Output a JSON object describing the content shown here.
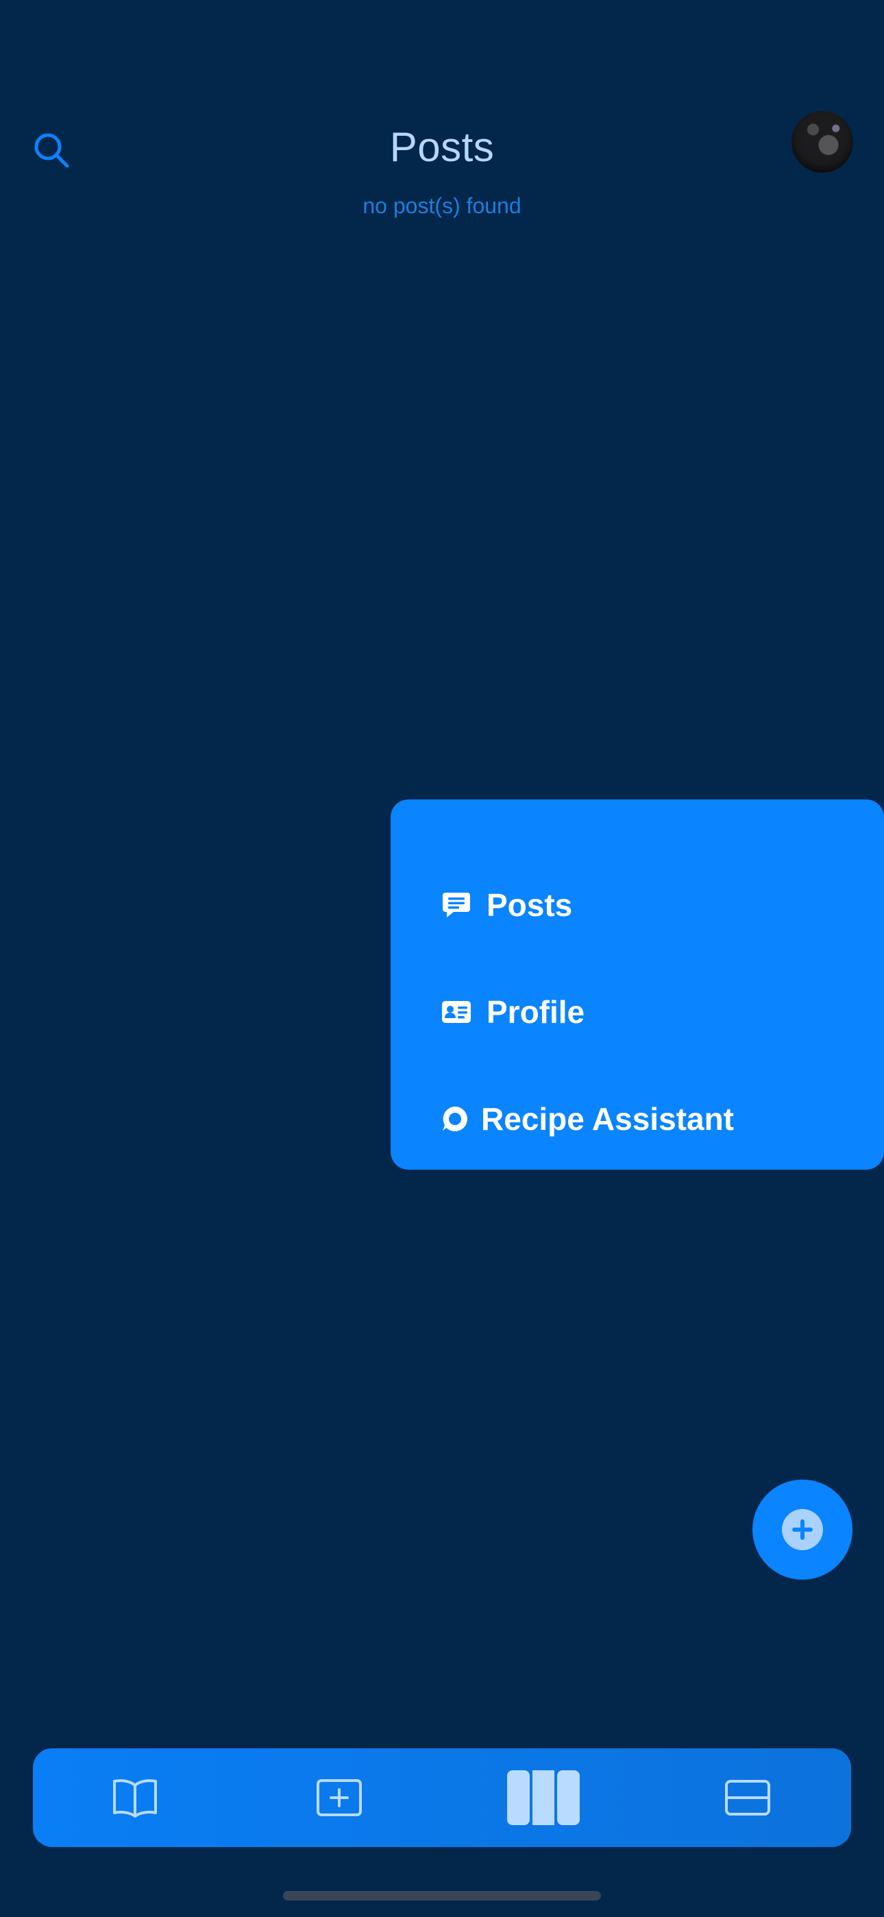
{
  "header": {
    "title": "Posts",
    "subtitle": "no post(s) found"
  },
  "menu": {
    "items": [
      {
        "label": "Posts",
        "icon": "chat-bubble-icon"
      },
      {
        "label": "Profile",
        "icon": "id-card-icon"
      },
      {
        "label": "Recipe Assistant",
        "icon": "message-circle-icon"
      }
    ]
  },
  "fab": {
    "icon": "plus-circle-icon"
  },
  "tabbar": {
    "tabs": [
      {
        "icon": "book-icon",
        "active": false
      },
      {
        "icon": "plus-square-icon",
        "active": false
      },
      {
        "icon": "columns-icon",
        "active": true
      },
      {
        "icon": "card-icon",
        "active": false
      }
    ]
  },
  "colors": {
    "background": "#03264b",
    "accent": "#0a84ff",
    "title": "#b7d6f8",
    "subtitle": "#1a7fe0",
    "tab_icon": "#b9dbff"
  }
}
